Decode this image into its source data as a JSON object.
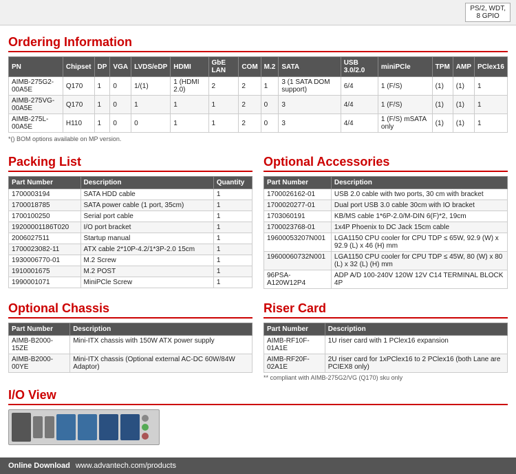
{
  "top_strip": {
    "ps2_label": "PS/2, WDT,",
    "ps2_label2": "8 GPIO"
  },
  "ordering_section": {
    "title": "Ordering Information",
    "columns": [
      "PN",
      "Chipset",
      "DP",
      "VGA",
      "LVDS/eDP",
      "HDMI",
      "GbE LAN",
      "COM",
      "M.2",
      "SATA",
      "USB 3.0/2.0",
      "miniPCle",
      "TPM",
      "AMP",
      "PClex16"
    ],
    "rows": [
      [
        "AIMB-275G2-00A5E",
        "Q170",
        "1",
        "0",
        "1/(1)",
        "1 (HDMI 2.0)",
        "2",
        "2",
        "1",
        "3 (1 SATA DOM support)",
        "6/4",
        "1 (F/S)",
        "(1)",
        "(1)",
        "1"
      ],
      [
        "AIMB-275VG-00A5E",
        "Q170",
        "1",
        "0",
        "1",
        "1",
        "1",
        "2",
        "0",
        "3",
        "4/4",
        "1 (F/S)",
        "(1)",
        "(1)",
        "1"
      ],
      [
        "AIMB-275L-00A5E",
        "H110",
        "1",
        "0",
        "0",
        "1",
        "1",
        "2",
        "0",
        "3",
        "4/4",
        "1 (F/S) mSATA only",
        "(1)",
        "(1)",
        "1"
      ]
    ],
    "note": "*() BOM options available on MP version."
  },
  "packing_list": {
    "title": "Packing List",
    "columns": [
      "Part Number",
      "Description",
      "Quantity"
    ],
    "rows": [
      [
        "1700003194",
        "SATA HDD cable",
        "1"
      ],
      [
        "1700018785",
        "SATA power cable (1 port, 35cm)",
        "1"
      ],
      [
        "1700100250",
        "Serial port cable",
        "1"
      ],
      [
        "19200001186T020",
        "I/O port bracket",
        "1"
      ],
      [
        "2006027511",
        "Startup manual",
        "1"
      ],
      [
        "1700023082-11",
        "ATX cable 2*10P-4.2/1*3P-2.0 15cm",
        "1"
      ],
      [
        "1930006770-01",
        "M.2 Screw",
        "1"
      ],
      [
        "1910001675",
        "M.2 POST",
        "1"
      ],
      [
        "1990001071",
        "MiniPCle Screw",
        "1"
      ]
    ]
  },
  "optional_accessories": {
    "title": "Optional Accessories",
    "columns": [
      "Part Number",
      "Description"
    ],
    "rows": [
      [
        "1700026162-01",
        "USB 2.0 cable with two ports, 30 cm with bracket"
      ],
      [
        "1700020277-01",
        "Dual port USB 3.0 cable 30cm with IO bracket"
      ],
      [
        "1703060191",
        "KB/MS cable 1*6P-2.0/M-DIN 6(F)*2, 19cm"
      ],
      [
        "1700023768-01",
        "1x4P Phoenix to DC Jack 15cm cable"
      ],
      [
        "19600053207N001",
        "LGA1150 CPU cooler for CPU TDP ≤ 65W, 92.9 (W) x 92.9 (L) x 46 (H) mm"
      ],
      [
        "19600060732N001",
        "LGA1150 CPU cooler for CPU TDP ≤ 45W, 80 (W) x 80 (L) x 32 (L) (H) mm"
      ],
      [
        "96PSA-A120W12P4",
        "ADP A/D 100-240V 120W 12V C14 TERMINAL BLOCK 4P"
      ]
    ]
  },
  "optional_chassis": {
    "title": "Optional Chassis",
    "columns": [
      "Part Number",
      "Description"
    ],
    "rows": [
      [
        "AIMB-B2000-15ZE",
        "Mini-ITX chassis with 150W ATX power supply"
      ],
      [
        "AIMB-B2000-00YE",
        "Mini-ITX chassis (Optional external AC-DC 60W/84W Adaptor)"
      ]
    ]
  },
  "riser_card": {
    "title": "Riser Card",
    "columns": [
      "Part Number",
      "Description"
    ],
    "rows": [
      [
        "AIMB-RF10F-01A1E",
        "1U riser card with 1 PClex16 expansion"
      ],
      [
        "AIMB-RF20F-02A1E",
        "2U riser card for 1xPClex16 to 2 PClex16 (both Lane are PCIEX8 only)"
      ]
    ],
    "note": "** compliant with AIMB-275G2/VG (Q170) sku only"
  },
  "io_view": {
    "title": "I/O View"
  },
  "bottom_bar": {
    "label": "Online Download",
    "url": "www.advantech.com/products"
  }
}
